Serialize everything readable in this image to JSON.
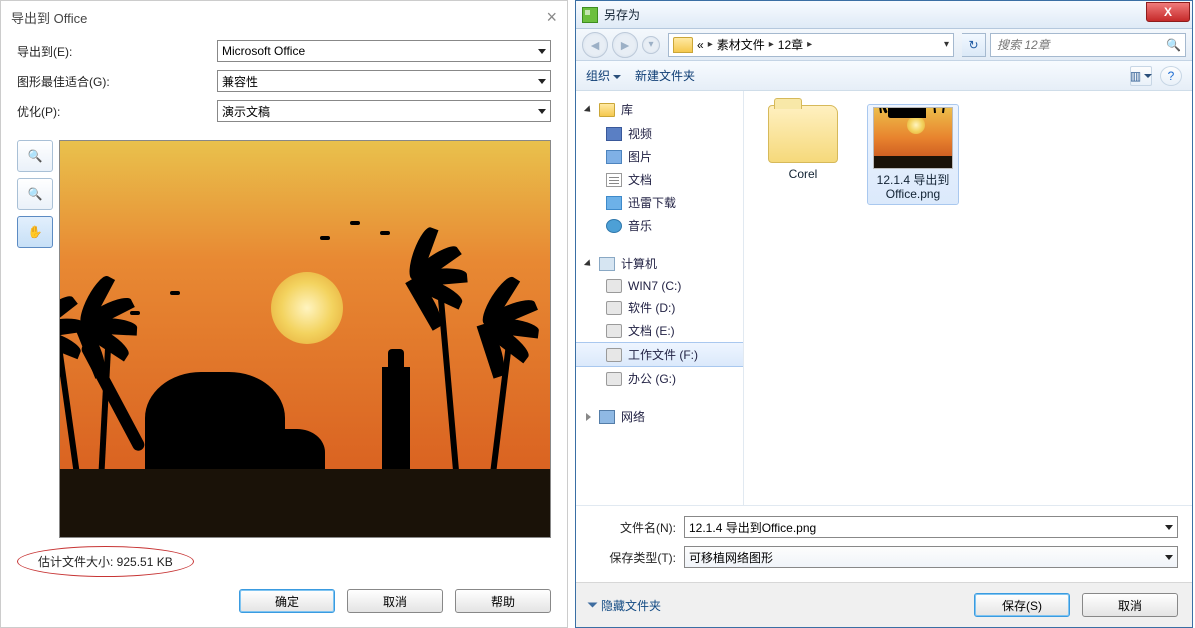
{
  "left": {
    "title": "导出到 Office",
    "rows": {
      "exportTo": {
        "label": "导出到(E):",
        "value": "Microsoft Office"
      },
      "bestFit": {
        "label": "图形最佳适合(G):",
        "value": "兼容性"
      },
      "optimize": {
        "label": "优化(P):",
        "value": "演示文稿"
      }
    },
    "tools": {
      "zoomIn": "zoom-in",
      "zoomOut": "zoom-out",
      "hand": "hand"
    },
    "estimate": "估计文件大小: 925.51 KB",
    "buttons": {
      "ok": "确定",
      "cancel": "取消",
      "help": "帮助"
    }
  },
  "right": {
    "title": "另存为",
    "breadcrumb": {
      "prefix": "«",
      "seg1": "素材文件",
      "seg2": "12章"
    },
    "searchPlaceholder": "搜索 12章",
    "toolbar": {
      "organize": "组织",
      "newFolder": "新建文件夹"
    },
    "nav": {
      "libraries": "库",
      "videos": "视频",
      "pictures": "图片",
      "documents": "文档",
      "xunlei": "迅雷下载",
      "music": "音乐",
      "computer": "计算机",
      "driveC": "WIN7 (C:)",
      "driveD": "软件 (D:)",
      "driveE": "文档 (E:)",
      "driveF": "工作文件 (F:)",
      "driveG": "办公 (G:)",
      "network": "网络"
    },
    "items": {
      "folder": "Corel",
      "file": "12.1.4 导出到Office.png"
    },
    "filename": {
      "label": "文件名(N):",
      "value": "12.1.4 导出到Office.png"
    },
    "filetype": {
      "label": "保存类型(T):",
      "value": "可移植网络图形"
    },
    "hideFolders": "隐藏文件夹",
    "buttons": {
      "save": "保存(S)",
      "cancel": "取消"
    }
  }
}
